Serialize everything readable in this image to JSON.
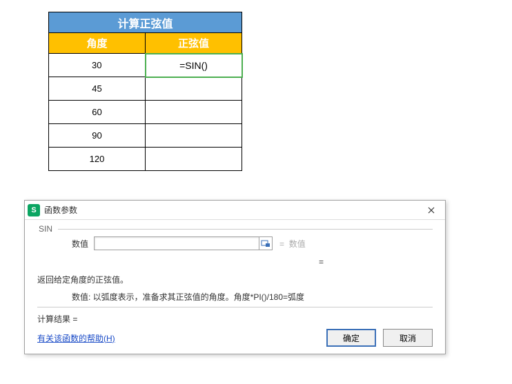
{
  "table": {
    "title": "计算正弦值",
    "headers": {
      "angle": "角度",
      "sine": "正弦值"
    },
    "rows": [
      {
        "angle": "30",
        "sine": "=SIN()"
      },
      {
        "angle": "45",
        "sine": ""
      },
      {
        "angle": "60",
        "sine": ""
      },
      {
        "angle": "90",
        "sine": ""
      },
      {
        "angle": "120",
        "sine": ""
      }
    ]
  },
  "dialog": {
    "title": "函数参数",
    "function_name": "SIN",
    "param_label": "数值",
    "param_value": "",
    "param_placeholder_result": "数值",
    "equals_sign": "=",
    "mid_equals": "=",
    "description": "返回给定角度的正弦值。",
    "param_description": "数值:  以弧度表示，准备求其正弦值的角度。角度*PI()/180=弧度",
    "result_label": "计算结果 =",
    "help_link": "有关该函数的帮助(H)",
    "ok_button": "确定",
    "cancel_button": "取消",
    "app_icon_letter": "S"
  }
}
